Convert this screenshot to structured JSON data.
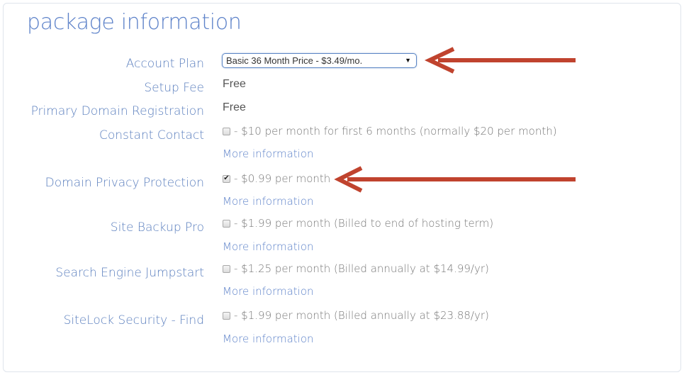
{
  "title": "package information",
  "account_plan": {
    "label": "Account Plan",
    "selected": "Basic 36 Month Price - $3.49/mo."
  },
  "setup_fee": {
    "label": "Setup Fee",
    "value": "Free"
  },
  "primary_domain": {
    "label": "Primary Domain Registration",
    "value": "Free"
  },
  "addons": [
    {
      "label": "Constant Contact",
      "checked": false,
      "price": "- $10 per month for first 6 months (normally $20 per month)",
      "link": "More information"
    },
    {
      "label": "Domain Privacy Protection",
      "checked": true,
      "price": "- $0.99 per month",
      "link": "More information"
    },
    {
      "label": "Site Backup Pro",
      "checked": false,
      "price": "- $1.99 per month (Billed to end of hosting term)",
      "link": "More information"
    },
    {
      "label": "Search Engine Jumpstart",
      "checked": false,
      "price": "- $1.25 per month (Billed annually at $14.99/yr)",
      "link": "More information"
    },
    {
      "label": "SiteLock Security - Find",
      "checked": false,
      "price": "- $1.99 per month (Billed annually at $23.88/yr)",
      "link": "More information"
    }
  ],
  "icons": {
    "caret": "▼",
    "check": "✔"
  },
  "colors": {
    "accent": "#5d82c9",
    "arrow": "#c0432e"
  }
}
